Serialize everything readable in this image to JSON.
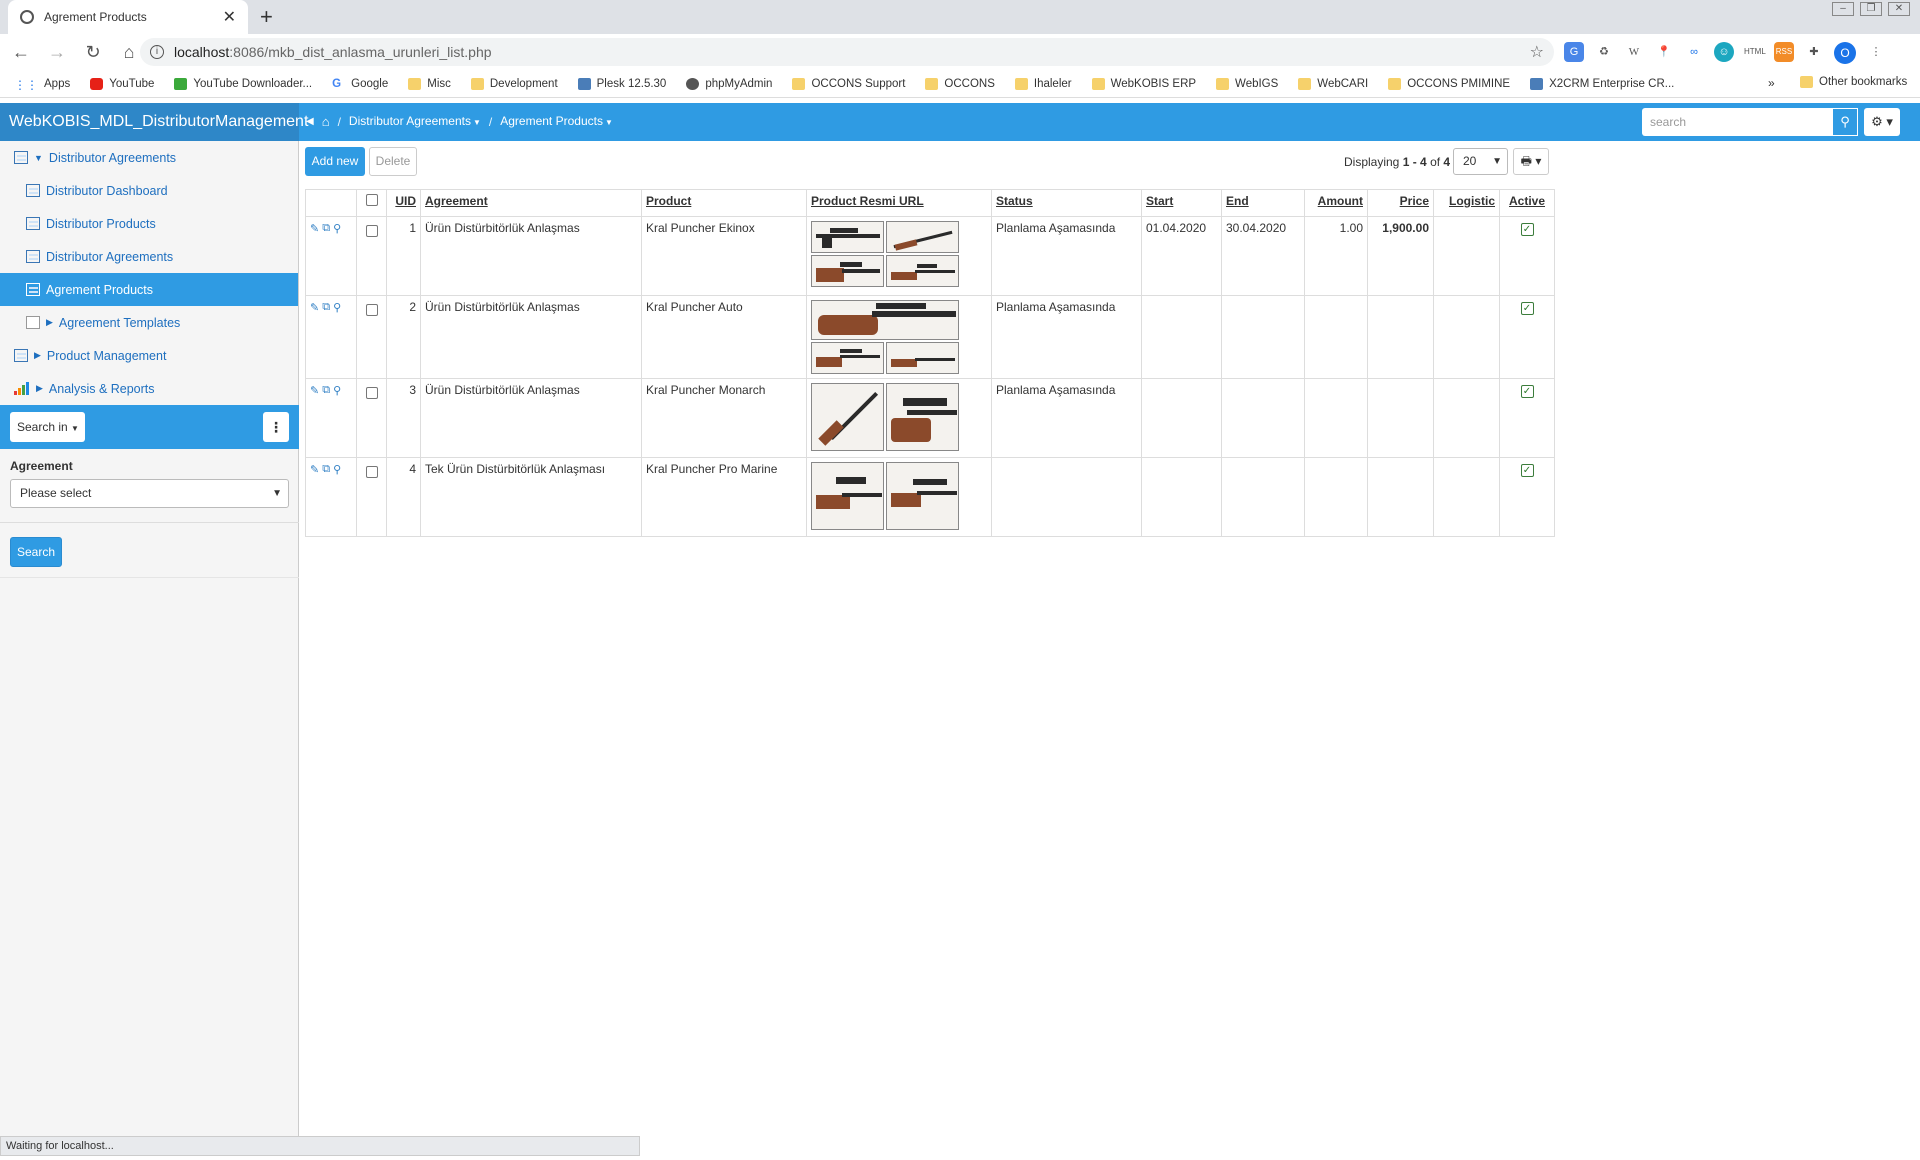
{
  "browser": {
    "tab_title": "Agrement Products",
    "url_host": "localhost",
    "url_rest": ":8086/mkb_dist_anlasma_urunleri_list.php",
    "profile_initial": "O",
    "bookmarks": [
      "Apps",
      "YouTube",
      "YouTube Downloader...",
      "Google",
      "Misc",
      "Development",
      "Plesk 12.5.30",
      "phpMyAdmin",
      "OCCONS Support",
      "OCCONS",
      "Ihaleler",
      "WebKOBIS ERP",
      "WebIGS",
      "WebCARI",
      "OCCONS PMIMINE",
      "X2CRM Enterprise CR..."
    ],
    "more_bookmarks": "»",
    "other_bookmarks": "Other bookmarks"
  },
  "app": {
    "brand": "WebKOBIS_MDL_DistributorManagement",
    "breadcrumb": [
      "Distributor Agreements",
      "Agrement Products"
    ],
    "search_placeholder": "search"
  },
  "sidebar": {
    "items": [
      {
        "label": "Distributor Agreements"
      },
      {
        "label": "Distributor Dashboard"
      },
      {
        "label": "Distributor Products"
      },
      {
        "label": "Distributor Agreements"
      },
      {
        "label": "Agrement Products"
      },
      {
        "label": "Agreement Templates"
      },
      {
        "label": "Product Management"
      },
      {
        "label": "Analysis & Reports"
      }
    ],
    "search_in": "Search in",
    "filter_label": "Agreement",
    "filter_value": "Please select",
    "search_button": "Search"
  },
  "toolbar": {
    "add_new": "Add new",
    "delete": "Delete",
    "displaying_prefix": "Displaying",
    "range": "1 - 4",
    "of": "of",
    "total": "4",
    "per_page": "20"
  },
  "table": {
    "columns": [
      "UID",
      "Agreement",
      "Product",
      "Product Resmi URL",
      "Status",
      "Start",
      "End",
      "Amount",
      "Price",
      "Logistic",
      "Active"
    ],
    "rows": [
      {
        "uid": "1",
        "agreement": "Ürün Distürbitörlük Anlaşmas",
        "product": "Kral Puncher Ekinox",
        "status": "Planlama Aşamasında",
        "start": "01.04.2020",
        "end": "30.04.2020",
        "amount": "1.00",
        "price": "1,900.00",
        "logistic": "",
        "active": true
      },
      {
        "uid": "2",
        "agreement": "Ürün Distürbitörlük Anlaşmas",
        "product": "Kral Puncher Auto",
        "status": "Planlama Aşamasında",
        "start": "",
        "end": "",
        "amount": "",
        "price": "",
        "logistic": "",
        "active": true
      },
      {
        "uid": "3",
        "agreement": "Ürün Distürbitörlük Anlaşmas",
        "product": "Kral Puncher Monarch",
        "status": "Planlama Aşamasında",
        "start": "",
        "end": "",
        "amount": "",
        "price": "",
        "logistic": "",
        "active": true
      },
      {
        "uid": "4",
        "agreement": "Tek Ürün Distürbitörlük Anlaşması",
        "product": "Kral Puncher Pro Marine",
        "status": "",
        "start": "",
        "end": "",
        "amount": "",
        "price": "",
        "logistic": "",
        "active": true
      }
    ]
  },
  "statusbar": "Waiting for localhost..."
}
